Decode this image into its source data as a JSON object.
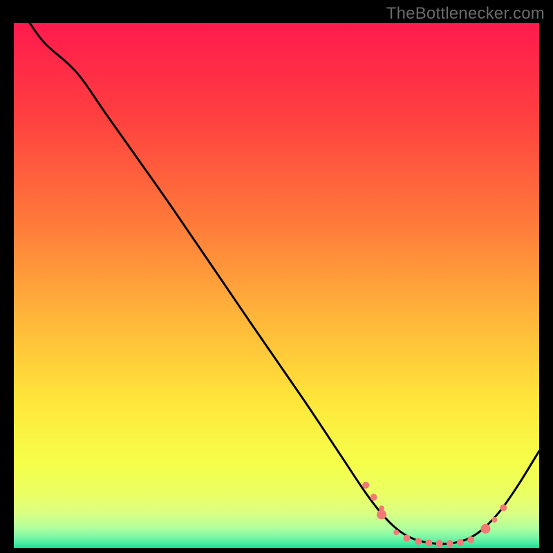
{
  "watermark": "TheBottlenecker.com",
  "chart_data": {
    "type": "line",
    "title": "",
    "xlabel": "",
    "ylabel": "",
    "xlim": [
      0,
      100
    ],
    "ylim": [
      0,
      100
    ],
    "gradient_stops": [
      {
        "pct": 0.0,
        "color": "#ff1a4d"
      },
      {
        "pct": 0.18,
        "color": "#ff4040"
      },
      {
        "pct": 0.38,
        "color": "#ff7a3a"
      },
      {
        "pct": 0.55,
        "color": "#ffb23a"
      },
      {
        "pct": 0.72,
        "color": "#ffe63a"
      },
      {
        "pct": 0.84,
        "color": "#f5ff4a"
      },
      {
        "pct": 0.9,
        "color": "#eaff66"
      },
      {
        "pct": 0.935,
        "color": "#d9ff85"
      },
      {
        "pct": 0.962,
        "color": "#b0ff9e"
      },
      {
        "pct": 0.98,
        "color": "#78f7a6"
      },
      {
        "pct": 0.992,
        "color": "#40eaa0"
      },
      {
        "pct": 1.0,
        "color": "#18d890"
      }
    ],
    "series": [
      {
        "name": "bottleneck-curve",
        "stroke": "#000000",
        "points": [
          {
            "x": 3.0,
            "y": 100.0
          },
          {
            "x": 6.0,
            "y": 96.0
          },
          {
            "x": 12.0,
            "y": 90.5
          },
          {
            "x": 18.0,
            "y": 82.0
          },
          {
            "x": 30.0,
            "y": 65.0
          },
          {
            "x": 45.0,
            "y": 43.0
          },
          {
            "x": 55.0,
            "y": 28.5
          },
          {
            "x": 62.0,
            "y": 18.0
          },
          {
            "x": 67.0,
            "y": 10.5
          },
          {
            "x": 70.5,
            "y": 6.0
          },
          {
            "x": 73.5,
            "y": 3.2
          },
          {
            "x": 76.5,
            "y": 1.6
          },
          {
            "x": 80.0,
            "y": 0.9
          },
          {
            "x": 83.0,
            "y": 0.9
          },
          {
            "x": 86.0,
            "y": 1.6
          },
          {
            "x": 89.0,
            "y": 3.4
          },
          {
            "x": 92.5,
            "y": 7.0
          },
          {
            "x": 96.0,
            "y": 12.0
          },
          {
            "x": 100.0,
            "y": 18.5
          }
        ]
      }
    ],
    "markers": [
      {
        "x": 67.0,
        "y": 12.0,
        "r": 5
      },
      {
        "x": 68.5,
        "y": 9.7,
        "r": 5
      },
      {
        "x": 70.0,
        "y": 7.6,
        "r": 4
      },
      {
        "x": 70.0,
        "y": 6.4,
        "r": 7
      },
      {
        "x": 72.8,
        "y": 3.0,
        "r": 4
      },
      {
        "x": 74.8,
        "y": 1.9,
        "r": 5
      },
      {
        "x": 77.0,
        "y": 1.3,
        "r": 5
      },
      {
        "x": 79.0,
        "y": 1.0,
        "r": 5
      },
      {
        "x": 81.0,
        "y": 0.9,
        "r": 5
      },
      {
        "x": 83.0,
        "y": 0.9,
        "r": 5
      },
      {
        "x": 85.0,
        "y": 1.1,
        "r": 5
      },
      {
        "x": 87.0,
        "y": 1.6,
        "r": 5
      },
      {
        "x": 89.8,
        "y": 3.7,
        "r": 7
      },
      {
        "x": 91.5,
        "y": 5.4,
        "r": 4
      },
      {
        "x": 93.2,
        "y": 7.7,
        "r": 5
      }
    ],
    "marker_color": "#f27a76"
  }
}
